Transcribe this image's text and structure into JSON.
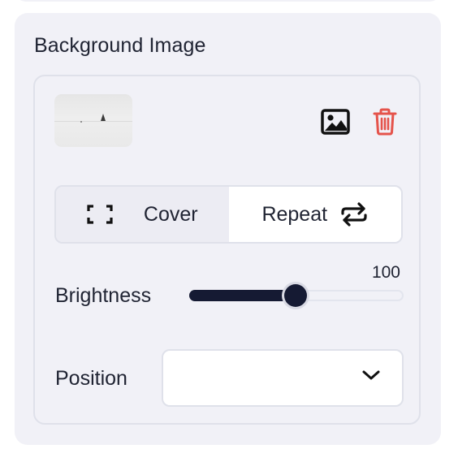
{
  "panel": {
    "title": "Background Image"
  },
  "image": {
    "thumbnail_icon": "snow-landscape-thumbnail",
    "replace_icon": "image-icon",
    "delete_icon": "trash-icon",
    "delete_color": "#e5534b"
  },
  "size_mode": {
    "options": [
      {
        "label": "Cover",
        "icon": "expand-corners-icon",
        "selected": true
      },
      {
        "label": "Repeat",
        "icon": "repeat-arrows-icon",
        "selected": false
      }
    ]
  },
  "brightness": {
    "label": "Brightness",
    "value": "100",
    "fill_fraction": 0.495
  },
  "position": {
    "label": "Position",
    "value": ""
  },
  "colors": {
    "panel_bg": "#f1f1f7",
    "accent": "#151a33",
    "text": "#202433",
    "border": "#dfe1ea"
  }
}
